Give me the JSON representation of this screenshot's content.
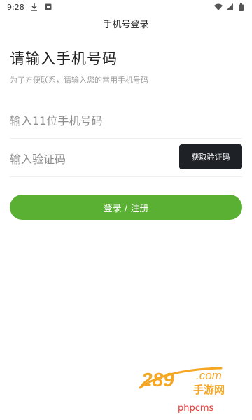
{
  "status_bar": {
    "time": "9:28",
    "icons": [
      "download-icon",
      "notification-icon",
      "wifi-icon",
      "signal-icon",
      "battery-icon"
    ]
  },
  "header": {
    "title": "手机号登录"
  },
  "login": {
    "title": "请输入手机号码",
    "subtitle": "为了方便联系，请输入您的常用手机号码",
    "phone_placeholder": "输入11位手机号码",
    "phone_value": "",
    "code_placeholder": "输入验证码",
    "code_value": "",
    "get_code_label": "获取验证码",
    "submit_label": "登录 / 注册"
  },
  "watermark": {
    "logo_number": "289",
    "logo_suffix": ".com",
    "logo_caption": "手游网",
    "site_text": "phpcms"
  },
  "colors": {
    "accent_green": "#5ab033",
    "dark_button": "#1e2227",
    "watermark_orange": "#f5a623",
    "watermark_red": "#e53935"
  }
}
